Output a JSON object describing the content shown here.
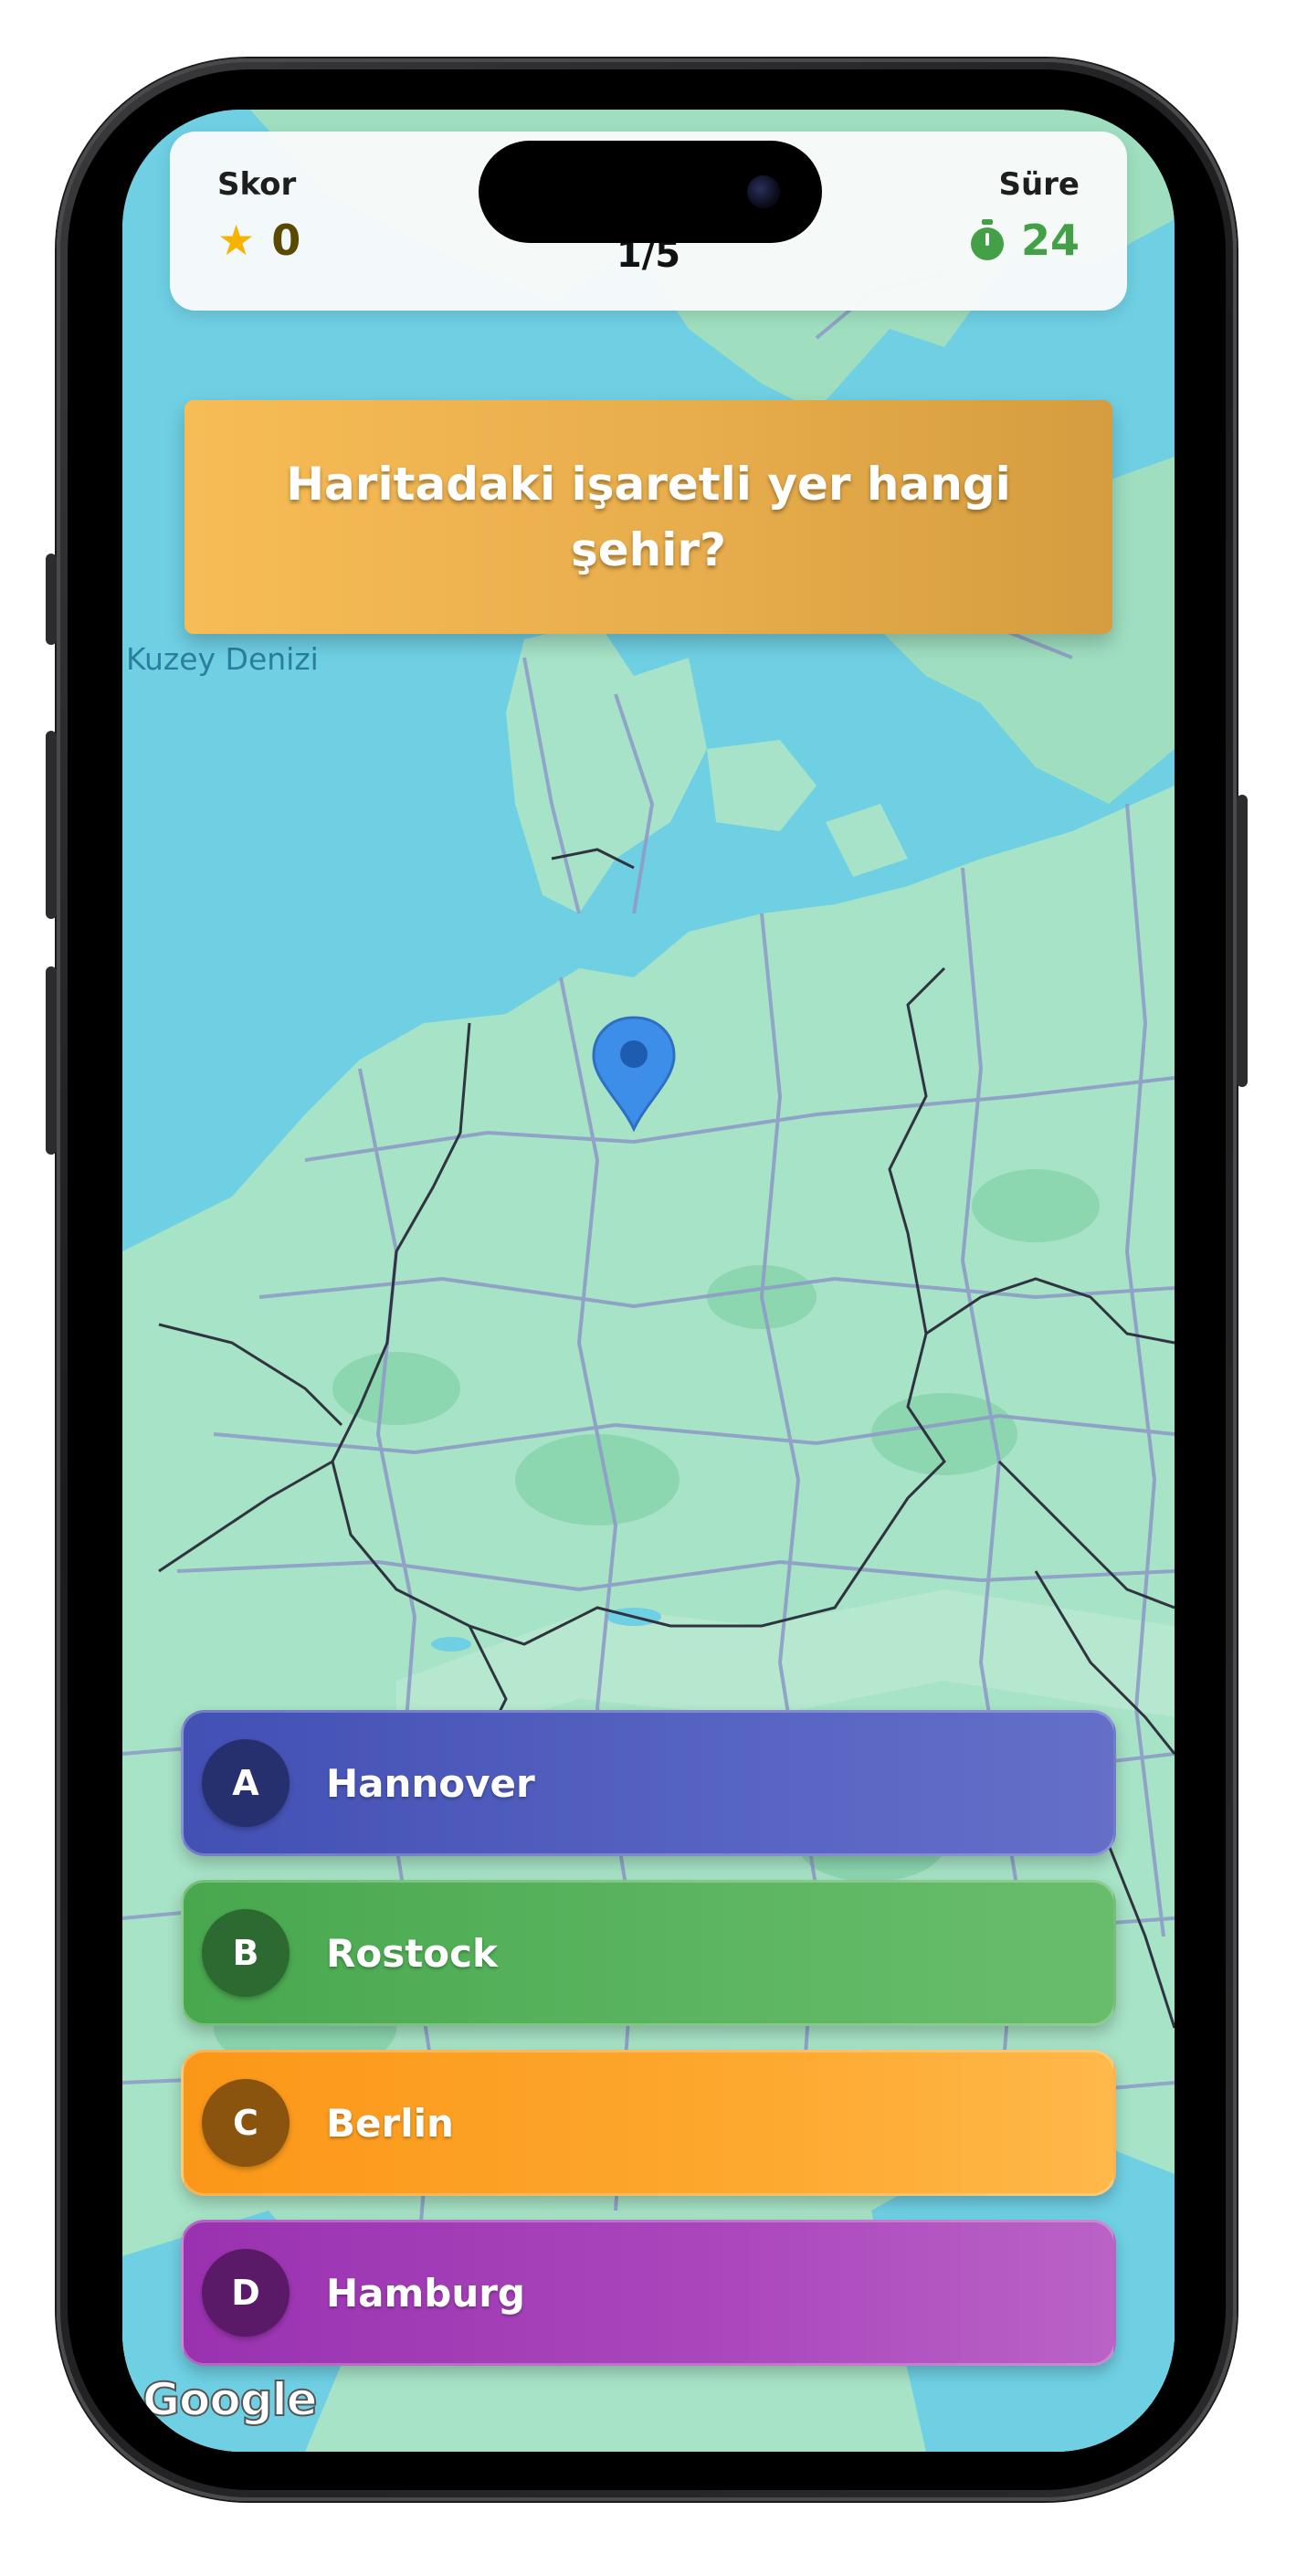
{
  "header": {
    "score_label": "Skor",
    "score_value": "0",
    "time_label": "Süre",
    "time_value": "24",
    "progress": "1/5",
    "star_icon": "star-icon",
    "timer_icon": "stopwatch-icon"
  },
  "question": {
    "text": "Haritadaki işaretli yer hangi şehir?"
  },
  "map": {
    "sea_label": "Kuzey Denizi",
    "attribution": "Google",
    "marker_icon": "map-pin-icon"
  },
  "answers": [
    {
      "letter": "A",
      "label": "Hannover",
      "color": "#4f5bbd"
    },
    {
      "letter": "B",
      "label": "Rostock",
      "color": "#56b25c"
    },
    {
      "letter": "C",
      "label": "Berlin",
      "color": "#fda126"
    },
    {
      "letter": "D",
      "label": "Hamburg",
      "color": "#a53fb8"
    }
  ]
}
